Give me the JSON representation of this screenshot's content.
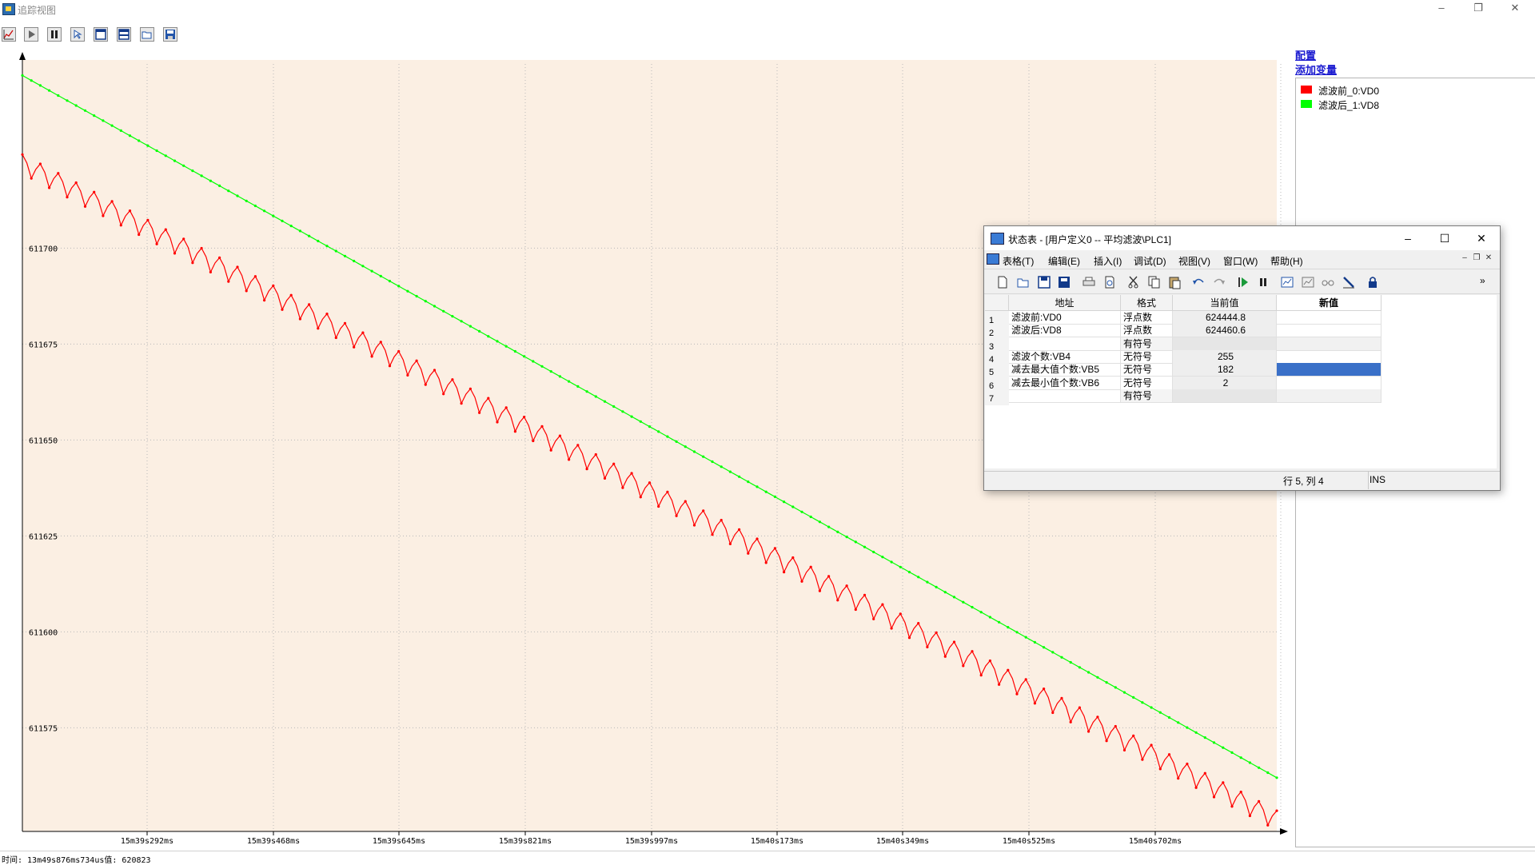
{
  "window": {
    "title": "追踪视图"
  },
  "toolbar": {
    "icons": [
      "chart-icon",
      "play-icon",
      "pause-icon",
      "cursor-icon",
      "window-icon",
      "split-icon",
      "open-folder-icon",
      "save-icon"
    ]
  },
  "right_panel": {
    "config_link": "配置",
    "add_variable_link": "添加变量",
    "legend": [
      {
        "label": "滤波前_0:VD0",
        "color": "#ff0000"
      },
      {
        "label": "滤波后_1:VD8",
        "color": "#00ff00"
      }
    ]
  },
  "chart_data": {
    "type": "line",
    "ylim": [
      611548,
      611748
    ],
    "y_ticks": [
      611575,
      611600,
      611625,
      611650,
      611675,
      611700
    ],
    "x_tick_labels": [
      "15m39s292ms",
      "15m39s468ms",
      "15m39s645ms",
      "15m39s821ms",
      "15m39s997ms",
      "15m40s173ms",
      "15m40s349ms",
      "15m40s525ms",
      "15m40s702ms"
    ],
    "series": [
      {
        "color": "#00ff00",
        "start": 611745,
        "end": 611562,
        "pattern": "smooth",
        "points": 281
      },
      {
        "color": "#ff0000",
        "start": 611722,
        "end": 611551,
        "pattern": "sawtooth",
        "points": 281
      }
    ],
    "grid": true
  },
  "status_bar": {
    "text": "时间: 13m49s876ms734us值: 620823"
  },
  "status_table_window": {
    "title": "状态表 - [用户定义0 -- 平均滤波\\PLC1]",
    "menu": [
      "表格(T)",
      "编辑(E)",
      "插入(I)",
      "调试(D)",
      "视图(V)",
      "窗口(W)",
      "帮助(H)"
    ],
    "columns": [
      "地址",
      "格式",
      "当前值",
      "新值"
    ],
    "rows": [
      {
        "n": "1",
        "address": "滤波前:VD0",
        "format": "浮点数",
        "current": "624444.8",
        "new": ""
      },
      {
        "n": "2",
        "address": "滤波后:VD8",
        "format": "浮点数",
        "current": "624460.6",
        "new": ""
      },
      {
        "n": "3",
        "address": "",
        "format": "有符号",
        "current": "",
        "new": ""
      },
      {
        "n": "4",
        "address": "滤波个数:VB4",
        "format": "无符号",
        "current": "255",
        "new": ""
      },
      {
        "n": "5",
        "address": "减去最大值个数:VB5",
        "format": "无符号",
        "current": "182",
        "new": ""
      },
      {
        "n": "6",
        "address": "减去最小值个数:VB6",
        "format": "无符号",
        "current": "2",
        "new": ""
      },
      {
        "n": "7",
        "address": "",
        "format": "有符号",
        "current": "",
        "new": ""
      }
    ],
    "selected_row": 5,
    "status_position": "行 5, 列 4",
    "status_mode": "INS"
  }
}
